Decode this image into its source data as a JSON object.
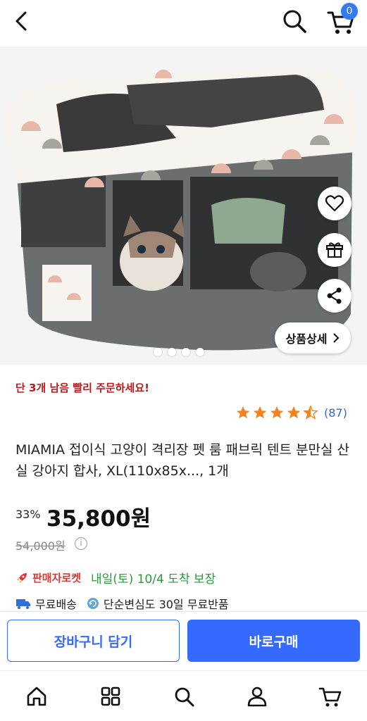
{
  "header": {
    "cart_count": "0"
  },
  "image": {
    "slides": 4,
    "current": 1
  },
  "buttons": {
    "detail_label": "상품상세"
  },
  "product": {
    "urgent": "단 3개 남음 빨리 주문하세요!",
    "rating": 4.5,
    "review_count": "(87)",
    "title": "MIAMIA 접이식 고양이 격리장 펫 룸 패브릭 텐트 분만실 산실 강아지 합사, XL(110x85x..., 1개",
    "discount": "33%",
    "price": "35,800원",
    "original_price": "54,000원"
  },
  "delivery": {
    "badge": "판매자로켓",
    "eta": "내일(토) 10/4 도착 보장"
  },
  "shipping": {
    "free_shipping": "무료배송",
    "return_policy": "단순변심도 30일 무료반품"
  },
  "actions": {
    "cart_label": "장바구니 담기",
    "buy_label": "바로구매"
  },
  "colors": {
    "accent": "#346aff",
    "urgent": "#c0191b",
    "delivery": "#2a9a3a",
    "star": "#f5821f"
  }
}
